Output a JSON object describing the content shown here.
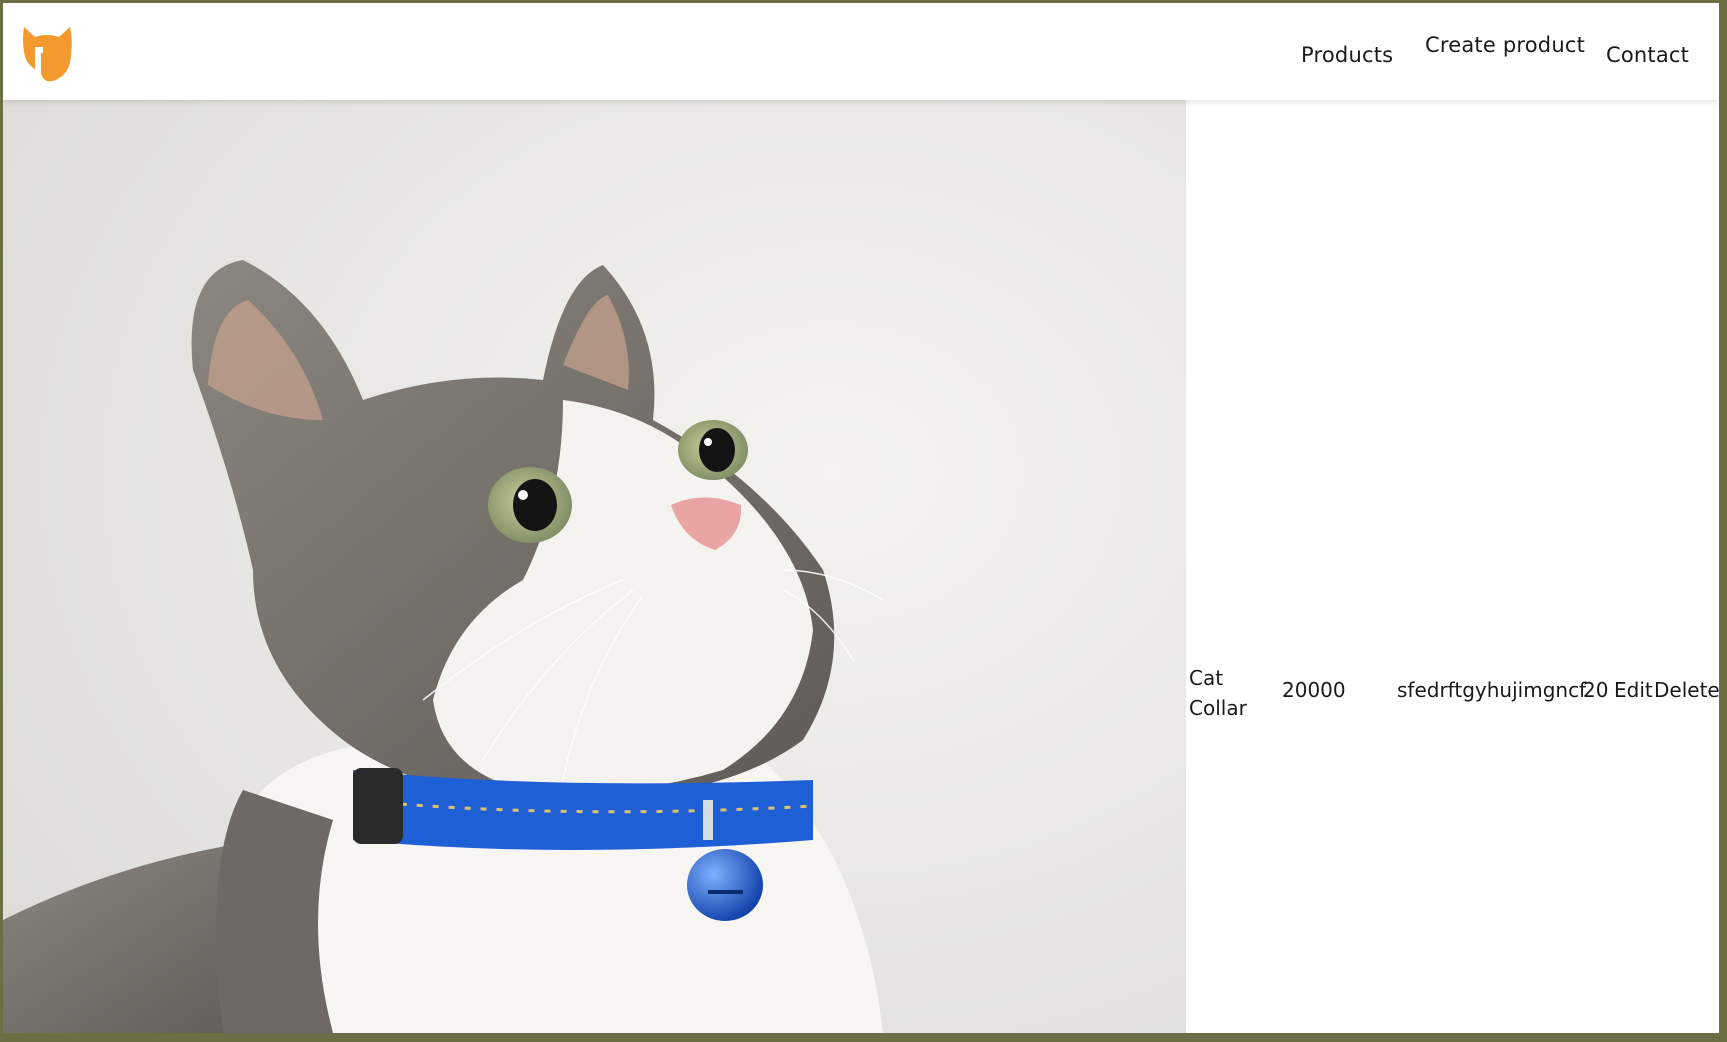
{
  "header": {
    "logo_icon": "cat-head-icon",
    "brand_color": "#f29a2e",
    "nav": {
      "products": "Products",
      "create_product": "Create product",
      "contact": "Contact"
    }
  },
  "product": {
    "image_icon": "cat-with-blue-collar-photo",
    "name": "Cat Collar",
    "price": "20000",
    "description": "sfedrftgyhujimgncf",
    "quantity": "20",
    "edit_label": "Edit",
    "delete_label": "Delete"
  },
  "colors": {
    "frame_border": "#6b6f43",
    "collar_blue": "#1f5fd6"
  }
}
